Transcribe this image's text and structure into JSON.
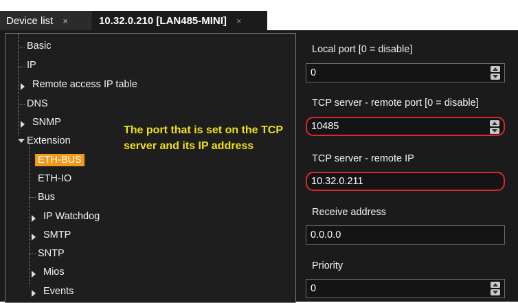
{
  "tabs": [
    {
      "label": "Device list",
      "close": "×"
    },
    {
      "label": "10.32.0.210 [LAN485-MINI]",
      "close": "×"
    }
  ],
  "tree": {
    "items": [
      {
        "label": "Basic"
      },
      {
        "label": "IP"
      },
      {
        "label": "Remote access IP table"
      },
      {
        "label": "DNS"
      },
      {
        "label": "SNMP"
      },
      {
        "label": "Extension"
      },
      {
        "label": "ETH-BUS",
        "selected": true
      },
      {
        "label": "ETH-IO"
      },
      {
        "label": "Bus"
      },
      {
        "label": "IP Watchdog"
      },
      {
        "label": "SMTP"
      },
      {
        "label": "SNTP"
      },
      {
        "label": "Mios"
      },
      {
        "label": "Events"
      }
    ]
  },
  "annotation": "The port that is set on the TCP server and its IP address",
  "form": {
    "local_port": {
      "label": "Local port [0 = disable]",
      "value": "0"
    },
    "remote_port": {
      "label": "TCP server - remote port [0 = disable]",
      "value": "10485"
    },
    "remote_ip": {
      "label": "TCP server - remote IP",
      "value": "10.32.0.211"
    },
    "receive_address": {
      "label": "Receive address",
      "value": "0.0.0.0"
    },
    "priority": {
      "label": "Priority",
      "value": "0"
    }
  },
  "colors": {
    "selected": "#f39a1b",
    "annotation": "#f0e018",
    "highlight": "#e0262e"
  }
}
